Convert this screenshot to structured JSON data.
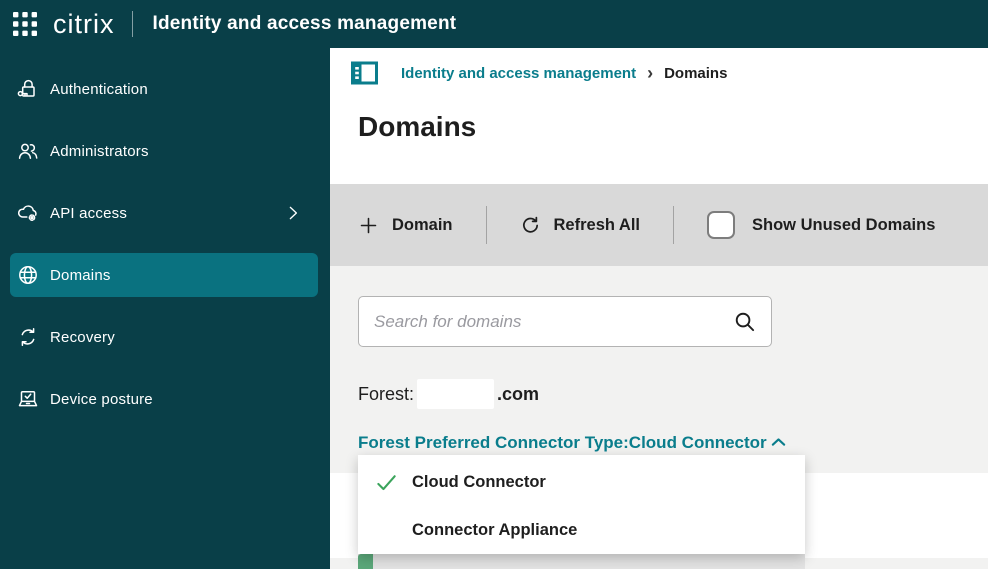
{
  "colors": {
    "teal_dark": "#093F48",
    "teal_selected": "#0A7280",
    "teal_link": "#0A7D8C",
    "green_check": "#3BA45C",
    "green_row_accent": "#5BA87A",
    "toolbar_bg": "#D9D9D9",
    "page_bg": "#F2F2F1"
  },
  "topbar": {
    "grid_icon": "app-grid-icon",
    "logo": "citrix",
    "title": "Identity and access management"
  },
  "sidebar": {
    "items": [
      {
        "label": "Authentication",
        "icon": "lock-key-icon",
        "selected": false
      },
      {
        "label": "Administrators",
        "icon": "people-icon",
        "selected": false
      },
      {
        "label": "API access",
        "icon": "cloud-gear-icon",
        "selected": false,
        "has_submenu": true
      },
      {
        "label": "Domains",
        "icon": "globe-icon",
        "selected": true
      },
      {
        "label": "Recovery",
        "icon": "refresh-cycle-icon",
        "selected": false
      },
      {
        "label": "Device posture",
        "icon": "laptop-check-icon",
        "selected": false
      }
    ]
  },
  "main": {
    "breadcrumb": {
      "icon": "panel-list-icon",
      "link": "Identity and access management",
      "separator": "›",
      "current": "Domains"
    },
    "page_title": "Domains",
    "toolbar": {
      "add_icon": "plus-icon",
      "add_button": "Domain",
      "refresh_icon": "refresh-icon",
      "refresh_button": "Refresh All",
      "checkbox_label": "Show Unused Domains",
      "checkbox_checked": false
    },
    "search": {
      "placeholder": "Search for domains",
      "value": "",
      "icon": "search-icon"
    },
    "forest": {
      "label": "Forest:",
      "name_redacted": true,
      "suffix": ".com"
    },
    "connector_link": {
      "label": "Forest Preferred Connector Type:",
      "value": "Cloud Connector",
      "caret": "chevron-up-icon"
    },
    "dropdown": {
      "options": [
        {
          "label": "Cloud Connector",
          "selected": true
        },
        {
          "label": "Connector Appliance",
          "selected": false
        }
      ]
    }
  }
}
